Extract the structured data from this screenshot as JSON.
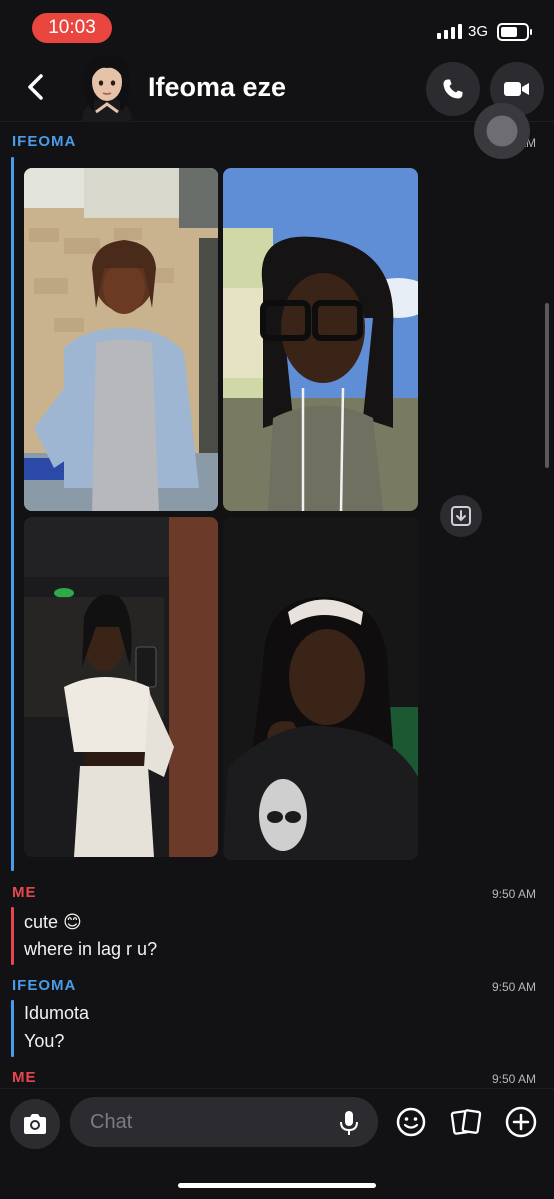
{
  "status_bar": {
    "time": "10:03",
    "network": "3G"
  },
  "header": {
    "contact_name": "Ifeoma eze"
  },
  "messages": [
    {
      "sender": "IFEOMA",
      "sender_color": "#4a9be8",
      "time": "9:49 AM"
    },
    {
      "sender": "ME",
      "sender_color": "#e8464f",
      "time": "9:50 AM",
      "lines": [
        "cute 😊",
        "where in lag r u?"
      ]
    },
    {
      "sender": "IFEOMA",
      "sender_color": "#4a9be8",
      "time": "9:50 AM",
      "lines": [
        "Idumota",
        "You?"
      ]
    },
    {
      "sender": "ME",
      "sender_color": "#e8464f",
      "time": "9:50 AM"
    }
  ],
  "composer": {
    "placeholder": "Chat"
  },
  "icons": {
    "back": "chevron-left-icon",
    "call": "phone-icon",
    "video": "video-camera-icon",
    "save": "save-download-icon",
    "camera": "camera-icon",
    "mic": "microphone-icon",
    "sticker": "smiley-icon",
    "cards": "cards-icon",
    "plus": "plus-icon"
  }
}
